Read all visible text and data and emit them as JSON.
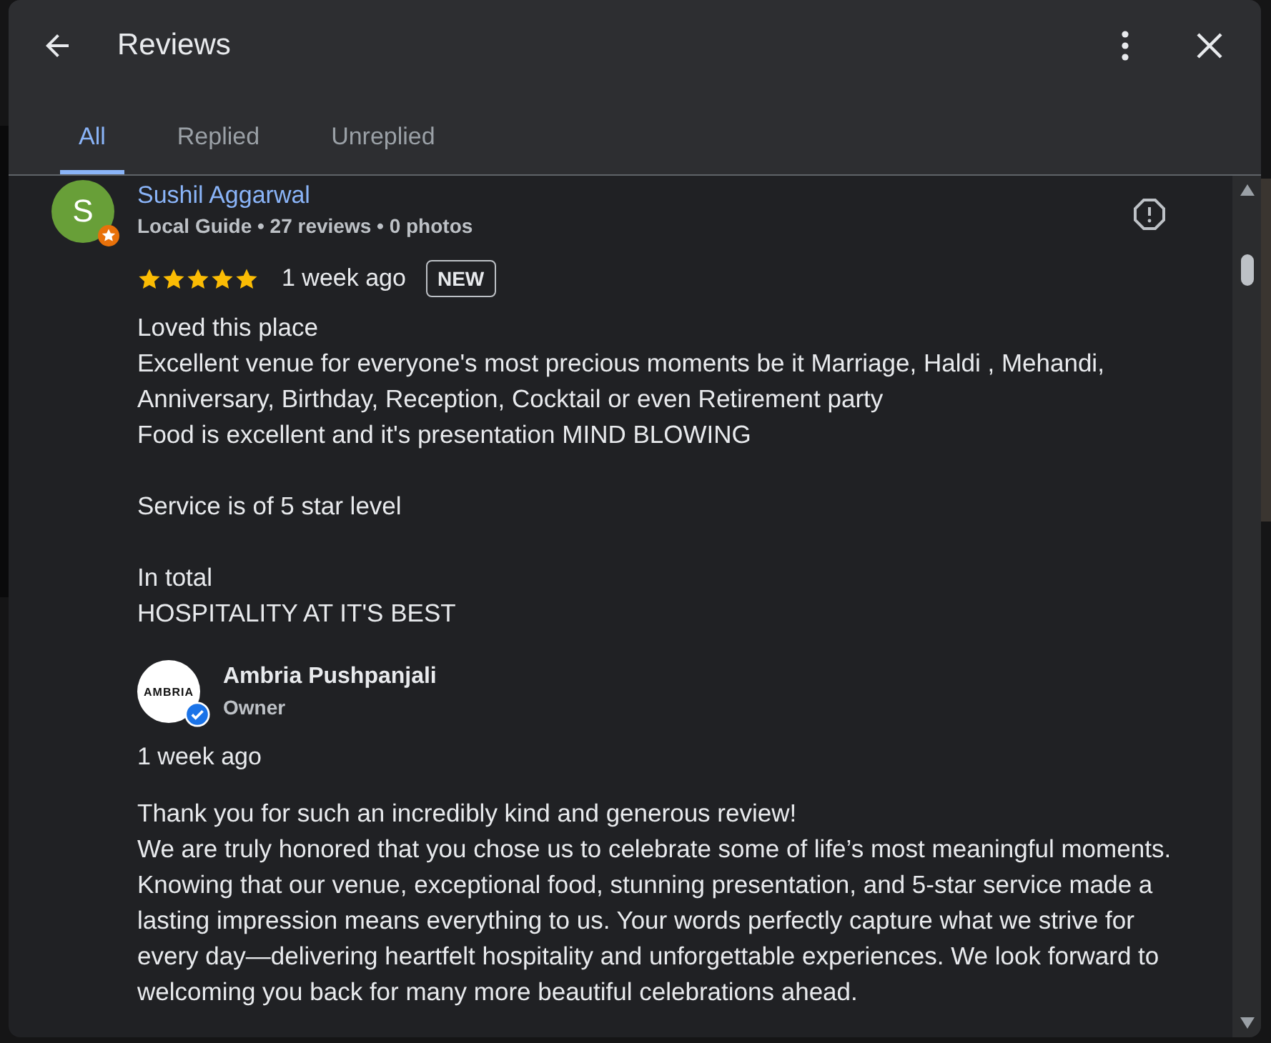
{
  "dialog": {
    "title": "Reviews"
  },
  "tabs": [
    {
      "label": "All",
      "selected": true
    },
    {
      "label": "Replied",
      "selected": false
    },
    {
      "label": "Unreplied",
      "selected": false
    }
  ],
  "review": {
    "avatar_letter": "S",
    "author": "Sushil Aggarwal",
    "local_guide": true,
    "meta": "Local Guide • 27 reviews • 0 photos",
    "stars": 5,
    "time": "1 week ago",
    "badge": "NEW",
    "paragraphs": [
      [
        "Loved this place",
        "Excellent venue for everyone's most precious moments be it Marriage, Haldi , Mehandi, Anniversary, Birthday, Reception, Cocktail or even Retirement party",
        "Food is excellent and it's presentation MIND BLOWING"
      ],
      [
        "Service is of 5 star level"
      ],
      [
        "In total",
        "HOSPITALITY AT IT'S BEST"
      ]
    ]
  },
  "reply": {
    "logo_text": "AMBRIA",
    "name": "Ambria Pushpanjali",
    "verified": true,
    "role": "Owner",
    "time": "1 week ago",
    "text": "Thank you for such an incredibly kind and generous review!\nWe are truly honored that you chose us to celebrate some of life’s most meaningful moments. Knowing that our venue, exceptional food, stunning presentation, and 5-star service made a lasting impression means everything to us. Your words perfectly capture what we strive for every day—delivering heartfelt hospitality and unforgettable experiences. We look forward to welcoming you back for many more beautiful celebrations ahead."
  }
}
